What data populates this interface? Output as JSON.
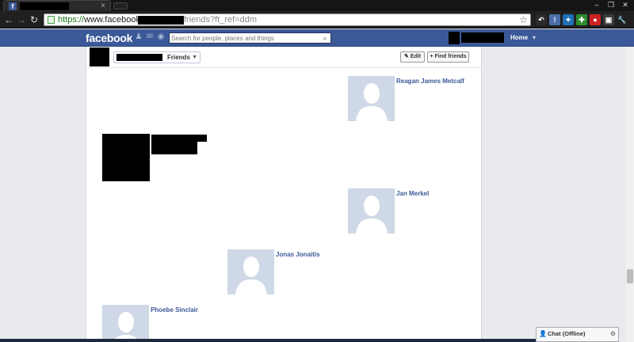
{
  "browser": {
    "tab_close": "×",
    "window_minimize": "–",
    "window_restore": "❐",
    "window_close": "✕",
    "back": "←",
    "forward": "→",
    "reload": "↻",
    "url_scheme": "https://",
    "url_host": "www.facebook.com/",
    "url_tail": "friends?ft_ref=ddm",
    "star_icon": "☆",
    "favicon": "f",
    "extensions": [
      {
        "name": "ext-back-icon",
        "glyph": "↶",
        "color": "#2b2b2b"
      },
      {
        "name": "ext-info-icon",
        "glyph": "!",
        "color": "#4c6ea8"
      },
      {
        "name": "ext-tool-icon",
        "glyph": "✦",
        "color": "#1d6fb8"
      },
      {
        "name": "ext-puzzle-icon",
        "glyph": "✚",
        "color": "#2e8b2e"
      },
      {
        "name": "ext-record-icon",
        "glyph": "●",
        "color": "#cc2222"
      },
      {
        "name": "ext-page-icon",
        "glyph": "▣",
        "color": "#3a3a3a"
      },
      {
        "name": "ext-wrench-icon",
        "glyph": "🔧",
        "color": "#202020"
      }
    ]
  },
  "fb": {
    "logo": "facebook",
    "search_placeholder": "Search for people, places and things",
    "search_icon": "⌕",
    "home": "Home",
    "account_caret": "▾",
    "jewels": [
      "♟",
      "✉",
      "◉"
    ]
  },
  "header": {
    "friends_label": "Friends",
    "caret": "▼",
    "edit": "✎ Edit",
    "find_friends": "+ Find friends"
  },
  "friends": [
    {
      "name": "Reagan James Metcalf"
    },
    {
      "name": "Jan Merkel"
    },
    {
      "name": "Jonas Jonaitis"
    },
    {
      "name": "Phoebe Sinclair"
    }
  ],
  "chat": {
    "icon": "👤",
    "label": "Chat (Offline)",
    "gear": "⚙"
  }
}
